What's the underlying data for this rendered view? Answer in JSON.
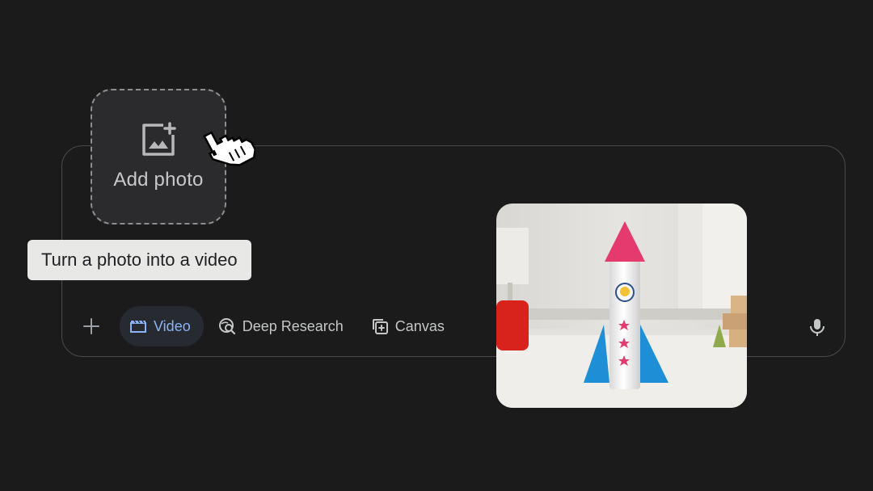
{
  "add_photo": {
    "label": "Add photo",
    "icon": "add-photo-icon"
  },
  "tooltip": {
    "text": "Turn a photo into a video"
  },
  "toolbar": {
    "plus_icon": "plus-icon",
    "tools": [
      {
        "label": "Video",
        "icon": "video-clapper-icon",
        "active": true
      },
      {
        "label": "Deep Research",
        "icon": "deep-research-icon",
        "active": false
      },
      {
        "label": "Canvas",
        "icon": "canvas-icon",
        "active": false
      }
    ],
    "mic_icon": "microphone-icon"
  },
  "colors": {
    "background": "#1b1b1c",
    "accent": "#8ab4f8",
    "chip_text": "#c4c7c5",
    "tooltip_bg": "#e8e8e6"
  }
}
